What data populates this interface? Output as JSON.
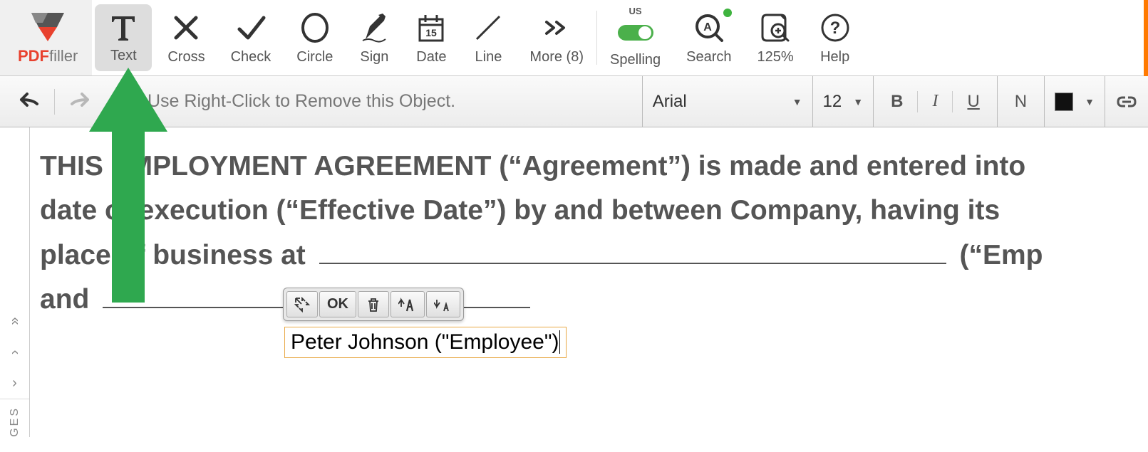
{
  "app": {
    "logo_pdf": "PDF",
    "logo_filler": "filler"
  },
  "tools": {
    "text": "Text",
    "cross": "Cross",
    "check": "Check",
    "circle": "Circle",
    "sign": "Sign",
    "date": "Date",
    "line": "Line",
    "more": "More (8)",
    "spelling": "Spelling",
    "spelling_lang": "US",
    "search": "Search",
    "zoom": "125%",
    "help": "Help"
  },
  "hint": {
    "text": "Use Right-Click to Remove this Object.",
    "bubble": "···"
  },
  "format": {
    "font_name": "Arial",
    "font_size": "12",
    "bold": "B",
    "italic": "I",
    "underline": "U",
    "normal": "N",
    "color": "#111111"
  },
  "document": {
    "line1": "THIS EMPLOYMENT AGREEMENT (“Agreement”) is made and entered into",
    "line2a": "date of execution (“Effective Date”) by and between Company, having its",
    "line3a": "place of business at",
    "line3c": "(“Emp",
    "line4a": "and"
  },
  "text_input": {
    "value": "Peter Johnson (\"Employee\")",
    "ok": "OK"
  },
  "nav": {
    "double_up": "«",
    "up": "‹",
    "next": "›",
    "label": "GES"
  }
}
